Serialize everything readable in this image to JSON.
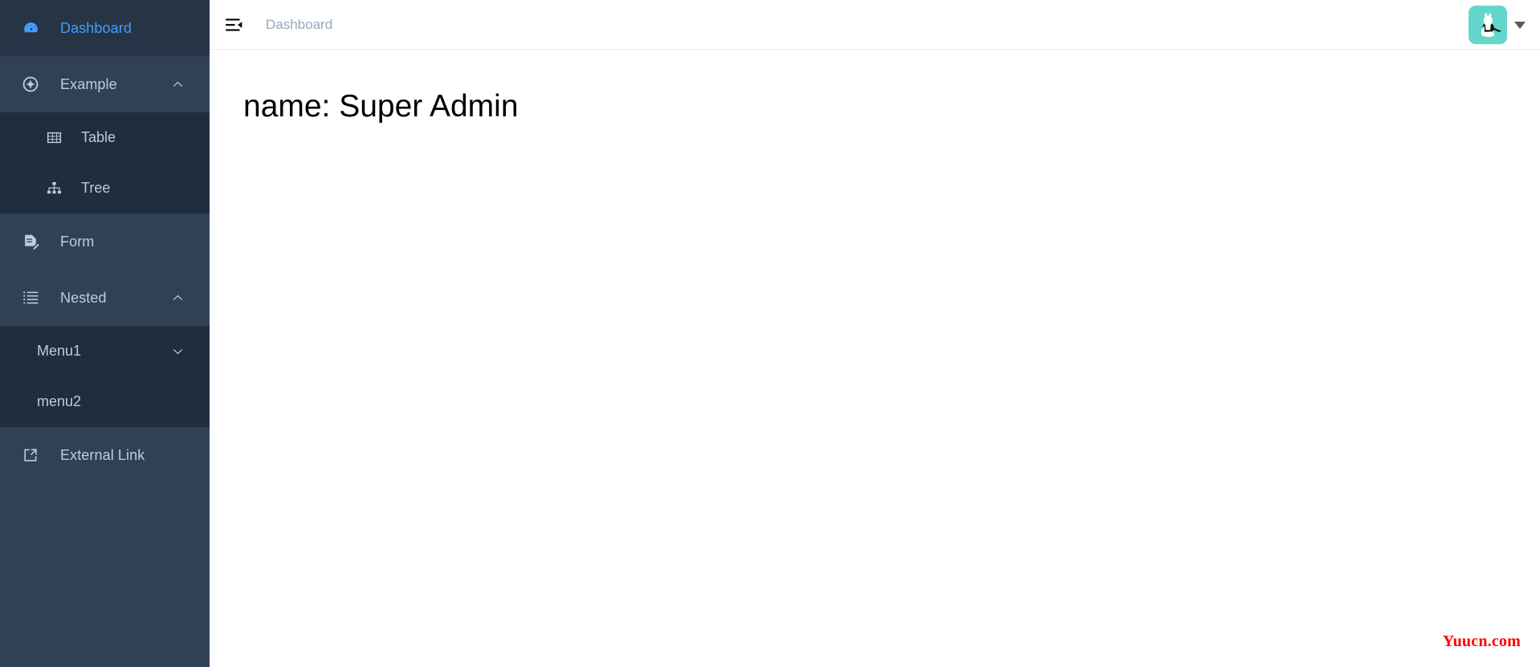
{
  "sidebar": {
    "items": [
      {
        "label": "Dashboard",
        "icon": "dashboard-icon",
        "active": true,
        "type": "link"
      },
      {
        "label": "Example",
        "icon": "compass-icon",
        "active": false,
        "type": "submenu",
        "arrow": "chevron-up-icon"
      },
      {
        "label": "Table",
        "icon": "table-icon",
        "active": false,
        "type": "sub"
      },
      {
        "label": "Tree",
        "icon": "tree-icon",
        "active": false,
        "type": "sub"
      },
      {
        "label": "Form",
        "icon": "form-icon",
        "active": false,
        "type": "link"
      },
      {
        "label": "Nested",
        "icon": "nested-list-icon",
        "active": false,
        "type": "submenu",
        "arrow": "chevron-up-icon"
      },
      {
        "label": "Menu1",
        "icon": "none",
        "active": false,
        "type": "sub",
        "arrow": "chevron-down-icon"
      },
      {
        "label": "menu2",
        "icon": "none",
        "active": false,
        "type": "sub"
      },
      {
        "label": "External Link",
        "icon": "external-link-icon",
        "active": false,
        "type": "link"
      }
    ]
  },
  "navbar": {
    "hamburger_icon": "hamburger-collapse-icon",
    "breadcrumb": "Dashboard",
    "avatar_icon": "user-avatar-rabbit",
    "caret_icon": "caret-down-icon"
  },
  "content": {
    "name_line": "name: Super Admin"
  },
  "watermark": {
    "text": "Yuucn.com"
  },
  "colors": {
    "sidebar_bg": "#304156",
    "submenu_bg": "#1f2d3d",
    "active_blue": "#409EFF",
    "menu_text": "#bfcbd9",
    "avatar_bg": "#65d6cb",
    "watermark_red": "#ff0000",
    "breadcrumb_text": "#97a8be"
  }
}
